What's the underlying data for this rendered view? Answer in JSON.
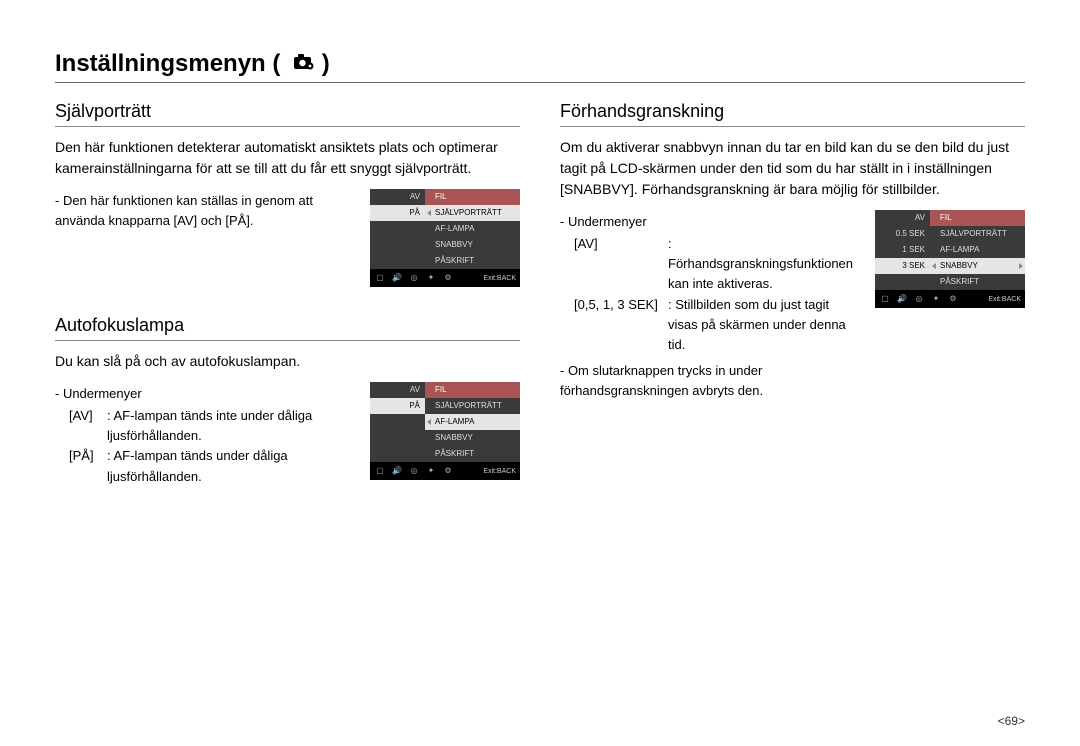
{
  "page_title_prefix": "Inställningsmenyn ( ",
  "page_title_suffix": " )",
  "page_number": "<69>",
  "sections": {
    "selfportrait": {
      "heading": "Självporträtt",
      "intro": "Den här funktionen detekterar automatiskt ansiktets plats och optimerar kamerainställningarna för att se till att du får ett snyggt självporträtt.",
      "note": "- Den här funktionen kan ställas in genom att använda knapparna [AV] och [PÅ].",
      "menu": {
        "left": [
          "AV",
          "PÅ",
          "",
          "",
          ""
        ],
        "right": [
          "FIL",
          "SJÄLVPORTRÄTT",
          "AF-LAMPA",
          "SNABBVY",
          "PÅSKRIFT"
        ],
        "selected_left_index": 1,
        "selected_right_index": 1,
        "exit": "Exit:BACK"
      }
    },
    "aflamp": {
      "heading": "Autofokuslampa",
      "intro": "Du kan slå på och av autofokuslampan.",
      "sub_label": "- Undermenyer",
      "items": [
        {
          "k": "[AV]",
          "v": ": AF-lampan tänds inte under dåliga ljusförhållanden."
        },
        {
          "k": "[PÅ]",
          "v": ": AF-lampan tänds under dåliga ljusförhållanden."
        }
      ],
      "menu": {
        "left": [
          "AV",
          "PÅ",
          "",
          "",
          ""
        ],
        "right": [
          "FIL",
          "SJÄLVPORTRÄTT",
          "AF-LAMPA",
          "SNABBVY",
          "PÅSKRIFT"
        ],
        "selected_left_index": 1,
        "selected_right_index": 2,
        "exit": "Exit:BACK"
      }
    },
    "preview": {
      "heading": "Förhandsgranskning",
      "intro": "Om du aktiverar snabbvyn innan du tar en bild kan du se den bild du just tagit på LCD-skärmen under den tid som du har ställt in i inställningen [SNABBVY]. Förhandsgranskning är bara möjlig för stillbilder.",
      "sub_label": "- Undermenyer",
      "items": [
        {
          "k": "[AV]",
          "v": ": Förhandsgranskningsfunktionen kan inte aktiveras."
        },
        {
          "k": "[0,5, 1, 3 SEK]",
          "v": ": Stillbilden som du just tagit visas på skärmen under denna tid."
        }
      ],
      "note2": "- Om slutarknappen trycks in under förhandsgranskningen avbryts den.",
      "menu": {
        "left": [
          "AV",
          "0.5 SEK",
          "1 SEK",
          "3 SEK",
          ""
        ],
        "right": [
          "FIL",
          "SJÄLVPORTRÄTT",
          "AF-LAMPA",
          "SNABBVY",
          "PÅSKRIFT"
        ],
        "selected_left_index": 3,
        "selected_right_index": 3,
        "exit": "Exit:BACK"
      }
    }
  }
}
